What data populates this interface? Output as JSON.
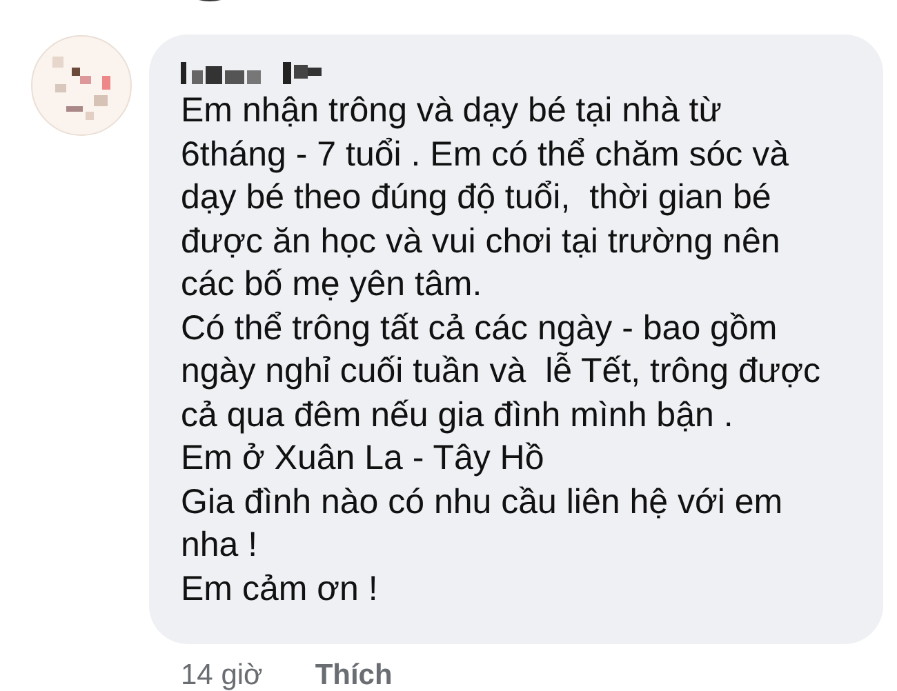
{
  "comment": {
    "lines": [
      "Em nhận trông và dạy bé tại nhà từ",
      "6tháng - 7 tuổi . Em có thể chăm sóc và",
      "dạy bé theo đúng độ tuổi,  thời gian bé",
      "được ăn học và vui chơi tại trường nên",
      "các bố mẹ yên tâm.",
      "Có thể trông tất cả các ngày - bao gồm",
      "ngày nghỉ cuối tuần và  lễ Tết, trông được",
      "cả qua đêm nếu gia đình mình bận .",
      "Em ở Xuân La - Tây Hồ",
      "Gia đình nào có nhu cầu liên hệ với em",
      "nha !",
      "Em cảm ơn !"
    ],
    "time": "14 giờ",
    "like": "Thích"
  }
}
